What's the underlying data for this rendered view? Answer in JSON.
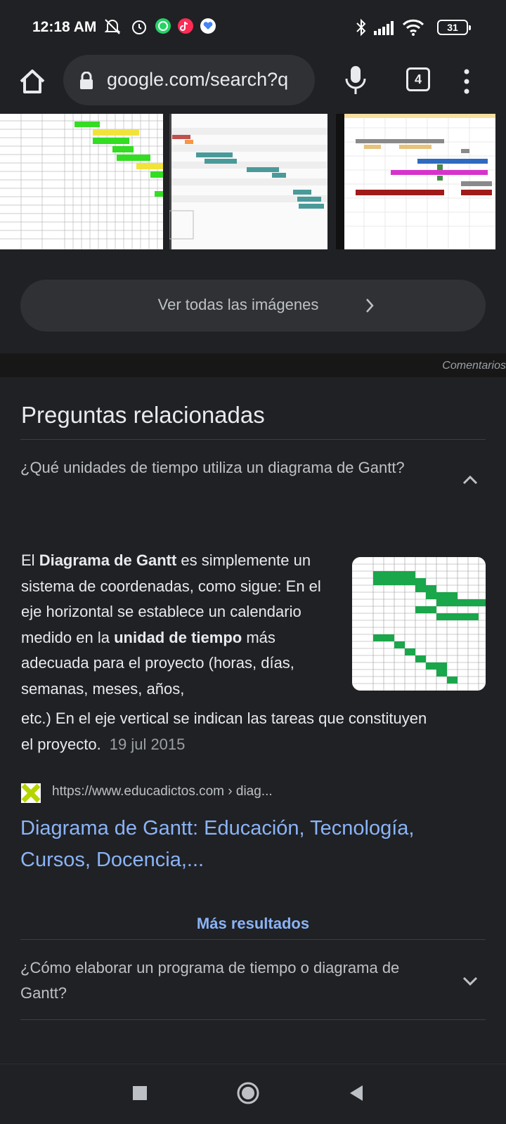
{
  "status": {
    "time": "12:18 AM",
    "battery": "31",
    "left_icons": [
      "bell-off-icon",
      "alarm-icon",
      "whatsapp-icon",
      "tiktok-icon",
      "health-heart-icon"
    ],
    "right_icons": [
      "bluetooth-icon",
      "signal-icon",
      "wifi-icon",
      "battery-icon"
    ]
  },
  "browser": {
    "url": "google.com/search?q",
    "tab_count": "4"
  },
  "images": {
    "see_all_label": "Ver todas las imágenes"
  },
  "feedback_label": "Comentarios",
  "related": {
    "title": "Preguntas relacionadas",
    "q1": "¿Qué unidades de tiempo utiliza un diagrama de Gantt?",
    "answer": {
      "p1_before": "El ",
      "p1_bold": "Diagrama de Gantt",
      "p1_after": " es simplemente un sistema de coordenadas, como sigue: En el eje horizontal se establece un calendario medido en la ",
      "p2_bold": "unidad de tiempo",
      "p2_after": " más adecuada para el proyecto (horas, días, semanas, meses, años,",
      "p3": "etc.) En el eje vertical se indican las tareas que constituyen el proyecto.",
      "date": "19 jul 2015"
    },
    "source": {
      "url": "https://www.educadictos.com › diag...",
      "title": "Diagrama de Gantt: Educación, Tecnología, Cursos, Docencia,..."
    },
    "more_results": "Más resultados",
    "q2": "¿Cómo elaborar un programa de tiempo o diagrama de Gantt?"
  },
  "colors": {
    "background": "#202124",
    "surface": "#303134",
    "link": "#8ab4f8",
    "text": "#e8eaed",
    "muted": "#bdc1c6"
  }
}
